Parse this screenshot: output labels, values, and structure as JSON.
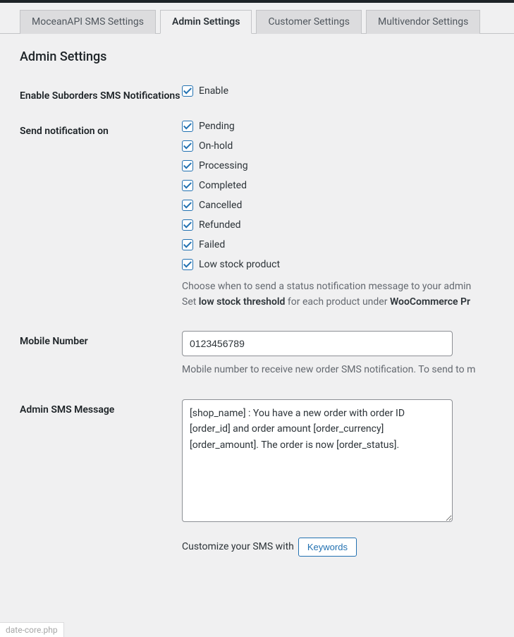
{
  "tabs": [
    {
      "label": "MoceanAPI SMS Settings",
      "active": false
    },
    {
      "label": "Admin Settings",
      "active": true
    },
    {
      "label": "Customer Settings",
      "active": false
    },
    {
      "label": "Multivendor Settings",
      "active": false
    }
  ],
  "page_title": "Admin Settings",
  "enable_suborders": {
    "label": "Enable Suborders SMS Notifications",
    "option_label": "Enable",
    "checked": true
  },
  "send_notification": {
    "label": "Send notification on",
    "options": [
      {
        "label": "Pending",
        "checked": true
      },
      {
        "label": "On-hold",
        "checked": true
      },
      {
        "label": "Processing",
        "checked": true
      },
      {
        "label": "Completed",
        "checked": true
      },
      {
        "label": "Cancelled",
        "checked": true
      },
      {
        "label": "Refunded",
        "checked": true
      },
      {
        "label": "Failed",
        "checked": true
      },
      {
        "label": "Low stock product",
        "checked": true
      }
    ],
    "desc_line1": "Choose when to send a status notification message to your admin",
    "desc_line2_a": "Set ",
    "desc_line2_b": "low stock threshold",
    "desc_line2_c": " for each product under ",
    "desc_line2_d": "WooCommerce Pr"
  },
  "mobile": {
    "label": "Mobile Number",
    "value": "0123456789",
    "desc": "Mobile number to receive new order SMS notification. To send to m"
  },
  "admin_msg": {
    "label": "Admin SMS Message",
    "value": "[shop_name] : You have a new order with order ID [order_id] and order amount [order_currency][order_amount]. The order is now [order_status].",
    "customize_prefix": "Customize your SMS with",
    "keywords_btn": "Keywords"
  },
  "status_path": "date-core.php"
}
